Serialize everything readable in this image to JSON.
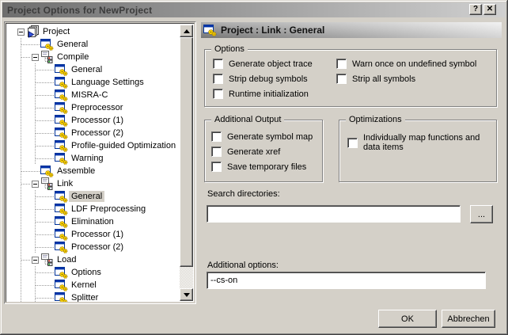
{
  "window": {
    "title": "Project Options for NewProject",
    "help_button": "?",
    "close_button": "✕"
  },
  "tree": {
    "items": [
      {
        "label": "Project",
        "level": 0,
        "icon": "project-icon",
        "expanded": true
      },
      {
        "label": "General",
        "level": 1,
        "icon": "settings-page-icon"
      },
      {
        "label": "Compile",
        "level": 1,
        "icon": "category-icon",
        "expanded": true
      },
      {
        "label": "General",
        "level": 2,
        "icon": "settings-page-icon"
      },
      {
        "label": "Language Settings",
        "level": 2,
        "icon": "settings-page-icon"
      },
      {
        "label": "MISRA-C",
        "level": 2,
        "icon": "settings-page-icon"
      },
      {
        "label": "Preprocessor",
        "level": 2,
        "icon": "settings-page-icon"
      },
      {
        "label": "Processor (1)",
        "level": 2,
        "icon": "settings-page-icon"
      },
      {
        "label": "Processor (2)",
        "level": 2,
        "icon": "settings-page-icon"
      },
      {
        "label": "Profile-guided Optimization",
        "level": 2,
        "icon": "settings-page-icon"
      },
      {
        "label": "Warning",
        "level": 2,
        "icon": "settings-page-icon"
      },
      {
        "label": "Assemble",
        "level": 1,
        "icon": "settings-page-icon"
      },
      {
        "label": "Link",
        "level": 1,
        "icon": "category-icon",
        "expanded": true
      },
      {
        "label": "General",
        "level": 2,
        "icon": "settings-page-icon",
        "selected": true
      },
      {
        "label": "LDF Preprocessing",
        "level": 2,
        "icon": "settings-page-icon"
      },
      {
        "label": "Elimination",
        "level": 2,
        "icon": "settings-page-icon"
      },
      {
        "label": "Processor (1)",
        "level": 2,
        "icon": "settings-page-icon"
      },
      {
        "label": "Processor (2)",
        "level": 2,
        "icon": "settings-page-icon"
      },
      {
        "label": "Load",
        "level": 1,
        "icon": "category-icon",
        "expanded": true
      },
      {
        "label": "Options",
        "level": 2,
        "icon": "settings-page-icon"
      },
      {
        "label": "Kernel",
        "level": 2,
        "icon": "settings-page-icon"
      },
      {
        "label": "Splitter",
        "level": 2,
        "icon": "settings-page-icon"
      }
    ]
  },
  "panel": {
    "header": {
      "title": "Project : Link : General",
      "icon": "settings-page-icon"
    },
    "options_group": {
      "title": "Options",
      "col1": [
        {
          "label": "Generate object trace",
          "checked": false
        },
        {
          "label": "Strip debug symbols",
          "checked": false
        },
        {
          "label": "Runtime initialization",
          "checked": false
        }
      ],
      "col2": [
        {
          "label": "Warn once on undefined symbol",
          "checked": false
        },
        {
          "label": "Strip all symbols",
          "checked": false
        }
      ]
    },
    "additional_output_group": {
      "title": "Additional Output",
      "items": [
        {
          "label": "Generate symbol map",
          "checked": false
        },
        {
          "label": "Generate xref",
          "checked": false
        },
        {
          "label": "Save temporary files",
          "checked": false
        }
      ]
    },
    "optimizations_group": {
      "title": "Optimizations",
      "items": [
        {
          "label": "Individually map functions and data items",
          "checked": false
        }
      ]
    },
    "search_directories": {
      "label": "Search directories:",
      "value": "",
      "browse_button": "..."
    },
    "additional_options": {
      "label": "Additional options:",
      "value": "--cs-on"
    }
  },
  "footer": {
    "ok_button": "OK",
    "cancel_button": "Abbrechen"
  },
  "colors": {
    "dialog_face": "#d4d0c8",
    "titlebar_gradient_left": "#6e6e6e",
    "titlebar_gradient_right": "#d0d0d0",
    "header_gradient_left": "#828282",
    "header_gradient_right": "#ebebeb",
    "selection_background": "#d4d0c8"
  }
}
